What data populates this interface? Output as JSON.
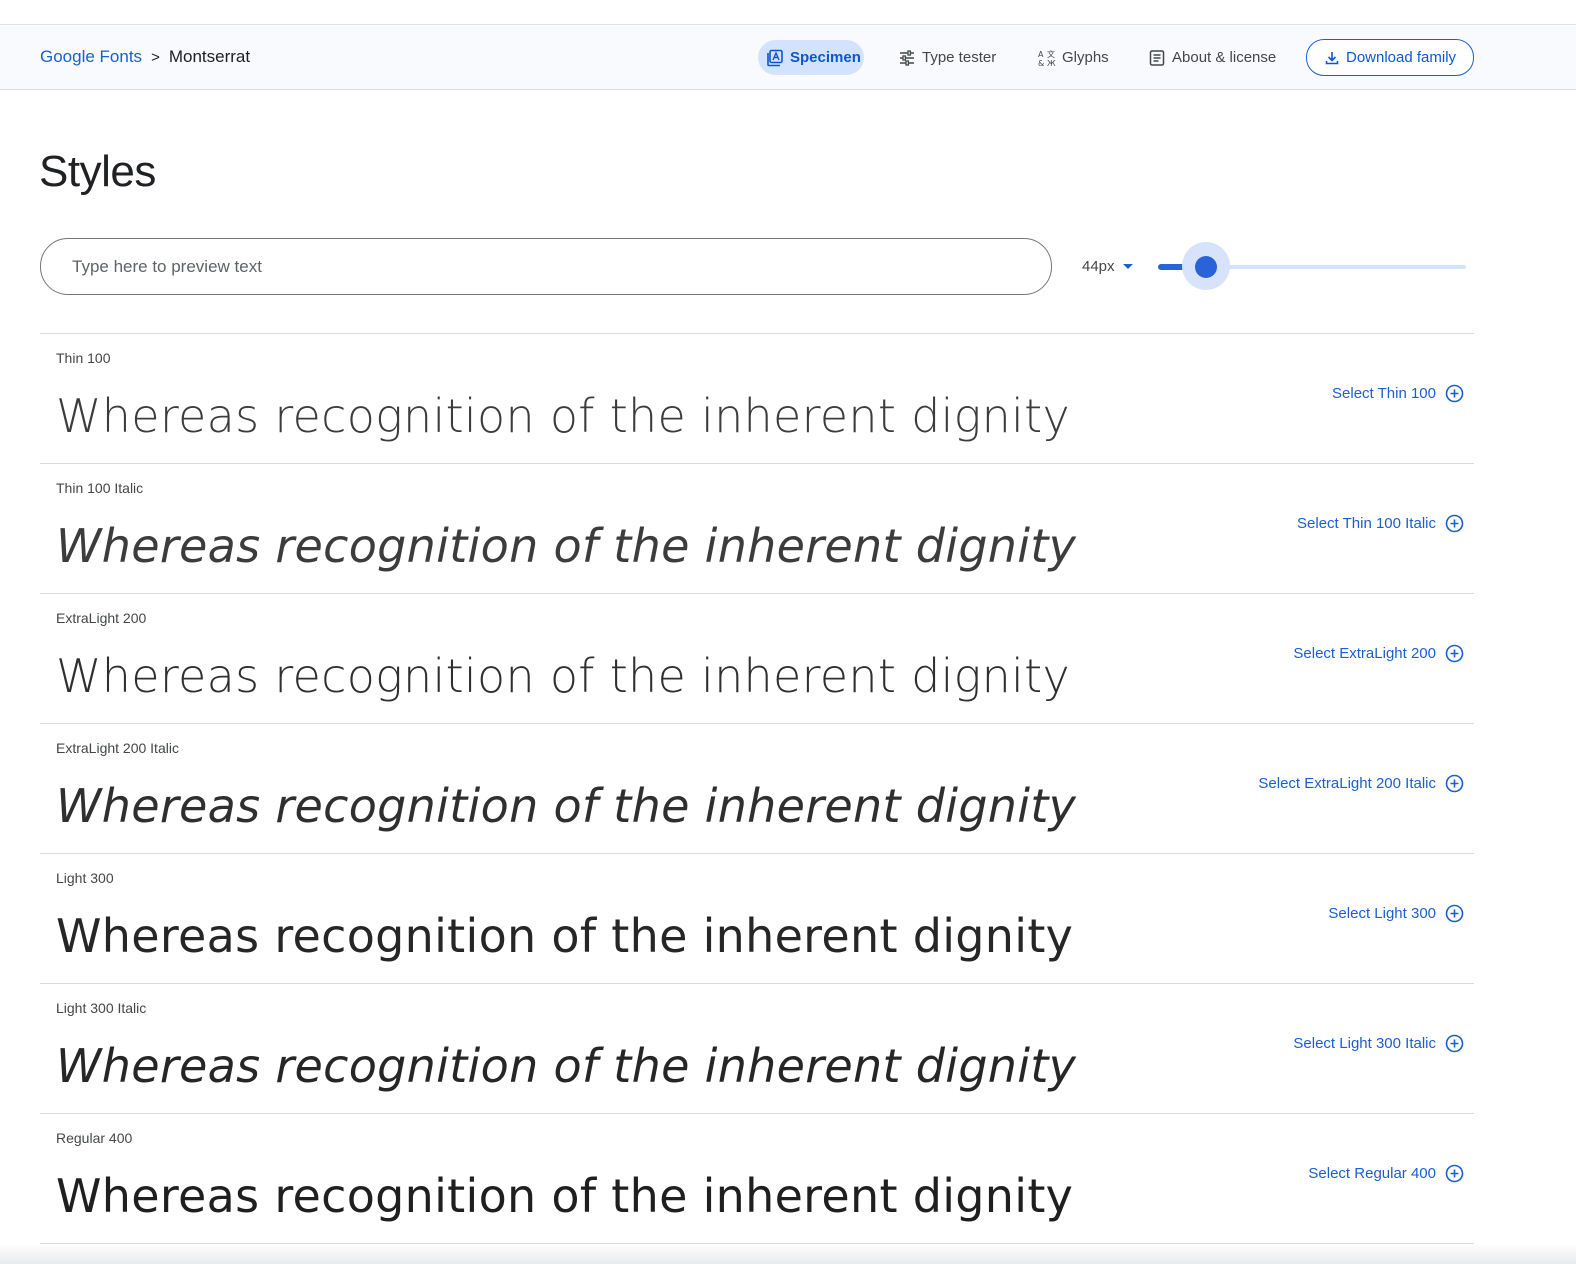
{
  "breadcrumb": {
    "root": "Google Fonts",
    "separator": ">",
    "current": "Montserrat"
  },
  "nav": {
    "specimen": "Specimen",
    "type_tester": "Type tester",
    "glyphs": "Glyphs",
    "about": "About & license",
    "download": "Download family"
  },
  "page": {
    "title": "Styles"
  },
  "preview": {
    "placeholder": "Type here to preview text",
    "value": ""
  },
  "size_control": {
    "value": "44px",
    "slider_fraction": 0.12
  },
  "colors": {
    "accent": "#1a5fd0",
    "active_tab_bg": "#d3e3fd",
    "header_bg": "#f8fafd"
  },
  "styles": [
    {
      "label": "Thin 100",
      "sample": "Whereas recognition of the inherent dignity",
      "select": "Select Thin 100"
    },
    {
      "label": "Thin 100 Italic",
      "sample": "Whereas recognition of the inherent dignity",
      "select": "Select Thin 100 Italic"
    },
    {
      "label": "ExtraLight 200",
      "sample": "Whereas recognition of the inherent dignity",
      "select": "Select ExtraLight 200"
    },
    {
      "label": "ExtraLight 200 Italic",
      "sample": "Whereas recognition of the inherent dignity",
      "select": "Select ExtraLight 200 Italic"
    },
    {
      "label": "Light 300",
      "sample": "Whereas recognition of the inherent dignity",
      "select": "Select Light 300"
    },
    {
      "label": "Light 300 Italic",
      "sample": "Whereas recognition of the inherent dignity",
      "select": "Select Light 300 Italic"
    },
    {
      "label": "Regular 400",
      "sample": "Whereas recognition of the inherent dignity",
      "select": "Select Regular 400"
    }
  ]
}
